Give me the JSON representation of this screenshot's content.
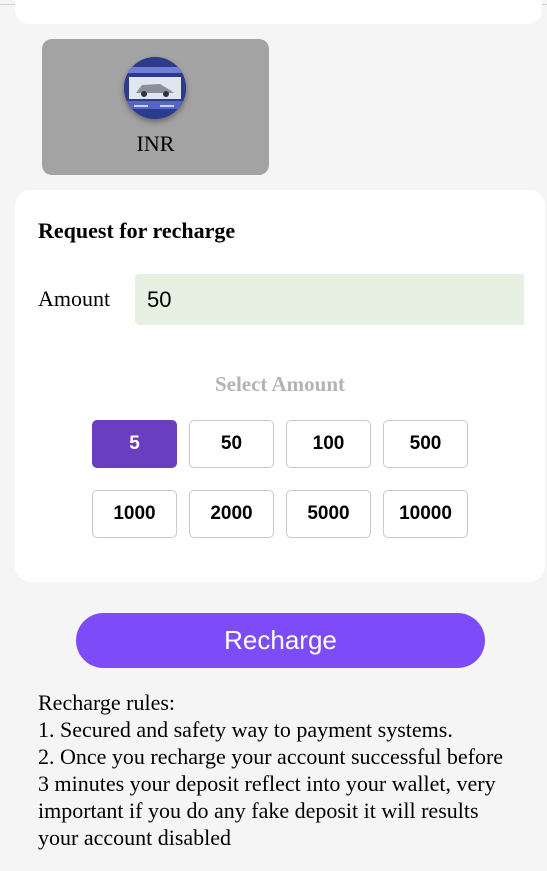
{
  "currency": {
    "label": "INR",
    "icon": "car-thumbnail-icon"
  },
  "recharge_card": {
    "title": "Request for recharge",
    "amount_label": "Amount",
    "amount_value": "50",
    "select_label": "Select Amount",
    "amounts": [
      "5",
      "50",
      "100",
      "500",
      "1000",
      "2000",
      "5000",
      "10000"
    ],
    "selected_amount": "5"
  },
  "recharge_button": {
    "label": "Recharge"
  },
  "rules": {
    "heading": "Recharge rules:",
    "items": [
      "1. Secured and safety way to payment systems.",
      "2. Once you recharge your account successful before 3 minutes your deposit reflect into your wallet, very important if you do any fake deposit it will results your account disabled"
    ]
  },
  "colors": {
    "accent": "#7d4cf8",
    "selected": "#6a3fbf",
    "input_bg": "#e6f1e4",
    "tile_bg": "#a3a3a3"
  }
}
